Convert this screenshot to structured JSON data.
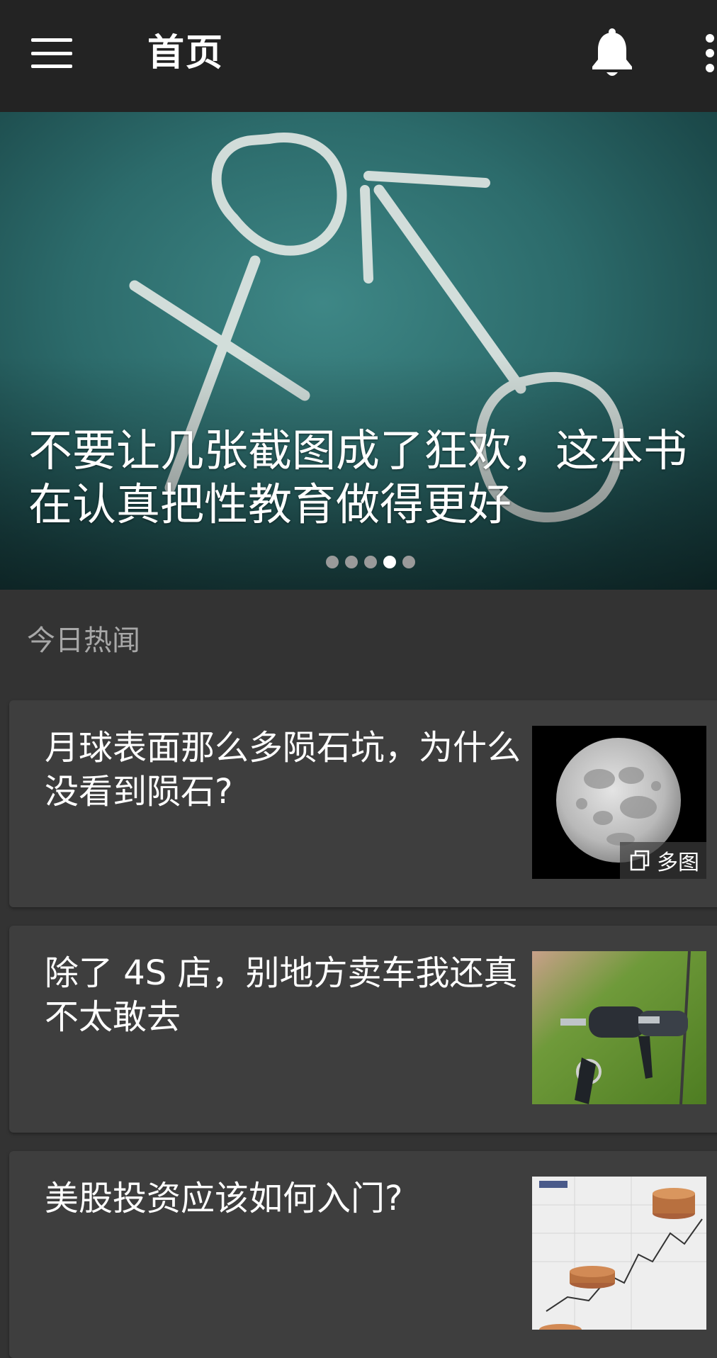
{
  "header": {
    "title": "首页",
    "menu_icon": "hamburger-menu-icon",
    "notification_icon": "bell-icon",
    "overflow_icon": "more-vertical-icon"
  },
  "hero": {
    "title": "不要让几张截图成了狂欢，这本书在认真把性教育做得更好",
    "image": "chalkboard-gender-symbols",
    "pager_count": 5,
    "pager_active": 4
  },
  "section": {
    "title": "今日热闻"
  },
  "articles": [
    {
      "title": "月球表面那么多陨石坑，为什么没看到陨石?",
      "image": "full-moon",
      "badge": "多图",
      "badge_icon": "gallery-icon"
    },
    {
      "title": "除了 4S 店，别地方卖车我还真不太敢去",
      "image": "car-keys"
    },
    {
      "title": "美股投资应该如何入门?",
      "image": "coins-stock-chart"
    }
  ]
}
